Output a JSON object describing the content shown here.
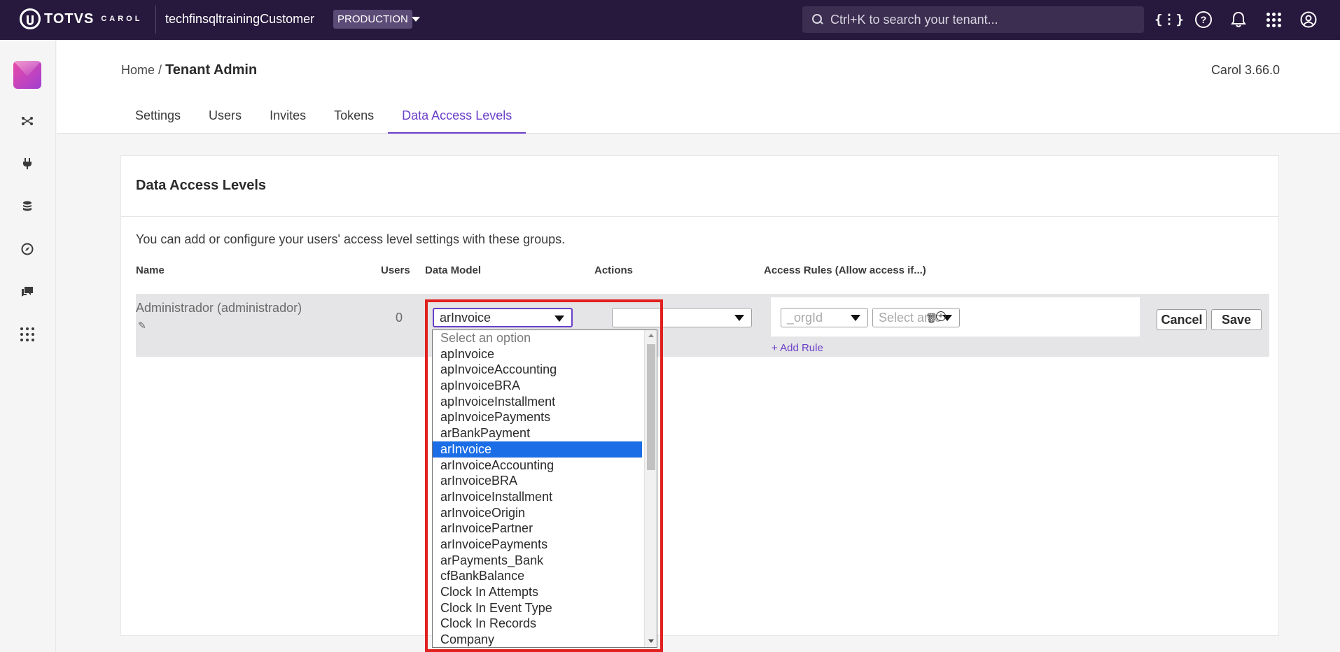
{
  "topbar": {
    "logo_text": "TOTVS",
    "logo_sub": "CAROL",
    "tenant_name": "techfinsqltrainingCustomer",
    "environment": "PRODUCTION",
    "search_placeholder": "Ctrl+K to search your tenant...",
    "icons": [
      "api-icon",
      "help-icon",
      "bell-icon",
      "apps-grid-icon",
      "user-icon"
    ]
  },
  "rail": {
    "icons": [
      "app-logo",
      "connector-icon",
      "plug-icon",
      "database-icon",
      "compass-icon",
      "chat-icon",
      "apps-icon"
    ]
  },
  "header": {
    "breadcrumb_home": "Home",
    "breadcrumb_sep": "/",
    "breadcrumb_current": "Tenant Admin",
    "version": "Carol 3.66.0",
    "tabs": [
      {
        "label": "Settings",
        "active": false
      },
      {
        "label": "Users",
        "active": false
      },
      {
        "label": "Invites",
        "active": false
      },
      {
        "label": "Tokens",
        "active": false
      },
      {
        "label": "Data Access Levels",
        "active": true
      }
    ]
  },
  "card": {
    "title": "Data Access Levels",
    "description": "You can add or configure your users' access level settings with these groups.",
    "columns": {
      "name": "Name",
      "users": "Users",
      "data_model": "Data Model",
      "actions": "Actions",
      "access_rules": "Access Rules (Allow access if...)"
    },
    "row": {
      "name": "Administrador (administrador)",
      "users": "0",
      "data_model_value": "arInvoice",
      "actions_value": "",
      "rule_field_placeholder": "_orgId",
      "rule_value_placeholder": "Select an c",
      "add_rule": "+ Add Rule",
      "cancel_label": "Cancel",
      "save_label": "Save"
    }
  },
  "dropdown": {
    "selected": "arInvoice",
    "options": [
      "Select an option",
      "apInvoice",
      "apInvoiceAccounting",
      "apInvoiceBRA",
      "apInvoiceInstallment",
      "apInvoicePayments",
      "arBankPayment",
      "arInvoice",
      "arInvoiceAccounting",
      "arInvoiceBRA",
      "arInvoiceInstallment",
      "arInvoiceOrigin",
      "arInvoicePartner",
      "arInvoicePayments",
      "arPayments_Bank",
      "cfBankBalance",
      "Clock In Attempts",
      "Clock In Event Type",
      "Clock In Records",
      "Company"
    ]
  },
  "colors": {
    "topbar": "#27193d",
    "accent": "#6a3fc8",
    "selection": "#1b6ee6",
    "highlight_border": "#e0211f"
  }
}
